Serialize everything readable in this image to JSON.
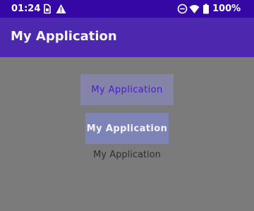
{
  "status_bar": {
    "time": "01:24",
    "battery_text": "100%",
    "icons": [
      "sim-card-icon",
      "warning-icon",
      "do-not-disturb-icon",
      "wifi-icon",
      "battery-icon"
    ]
  },
  "app_bar": {
    "title": "My Application"
  },
  "main": {
    "outline_button_label": "My Application",
    "filled_button_label": "My Application",
    "text_label": "My Application"
  },
  "colors": {
    "status_bar": "#3508a6",
    "app_bar": "#4b28ad",
    "background": "#7b7b7b",
    "accent": "#4b1bd2"
  }
}
